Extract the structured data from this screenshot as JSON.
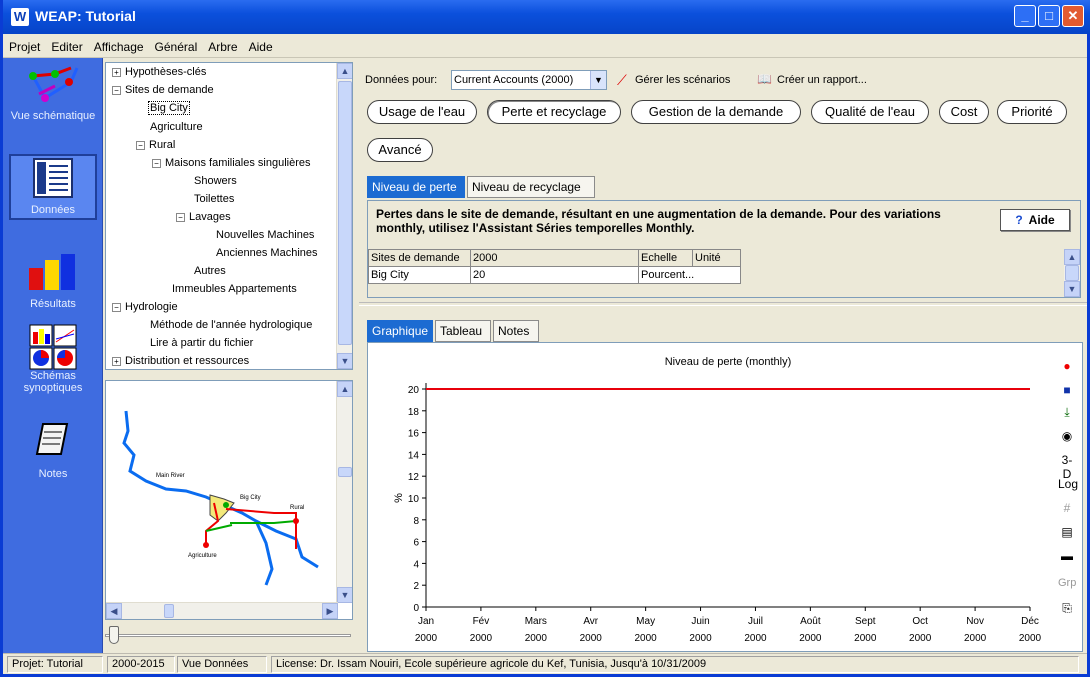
{
  "window": {
    "title": "WEAP: Tutorial",
    "app_icon": "W"
  },
  "menu": [
    "Projet",
    "Editer",
    "Affichage",
    "Général",
    "Arbre",
    "Aide"
  ],
  "nav": [
    {
      "label": "Vue schématique",
      "icon": "schematic-icon"
    },
    {
      "label": "Données",
      "icon": "data-icon"
    },
    {
      "label": "Résultats",
      "icon": "results-icon"
    },
    {
      "label": "Schémas synoptiques",
      "icon": "overviews-icon"
    },
    {
      "label": "Notes",
      "icon": "notes-icon"
    }
  ],
  "tree": [
    {
      "label": "Hypothèses-clés",
      "box": "+"
    },
    {
      "label": "Sites de demande",
      "box": "−"
    },
    {
      "label": "Big City",
      "selected": true
    },
    {
      "label": "Agriculture"
    },
    {
      "label": "Rural",
      "box": "−"
    },
    {
      "label": "Maisons familiales singulières",
      "box": "−"
    },
    {
      "label": "Showers"
    },
    {
      "label": "Toilettes"
    },
    {
      "label": "Lavages",
      "box": "−"
    },
    {
      "label": "Nouvelles Machines"
    },
    {
      "label": "Anciennes Machines"
    },
    {
      "label": "Autres"
    },
    {
      "label": "Immeubles Appartements"
    },
    {
      "label": "Hydrologie",
      "box": "−"
    },
    {
      "label": "Méthode de l'année hydrologique"
    },
    {
      "label": "Lire à partir du fichier"
    },
    {
      "label": "Distribution et ressources",
      "box": "+"
    }
  ],
  "map": {
    "labels": [
      "Main River",
      "Big City",
      "Rural",
      "Agriculture"
    ]
  },
  "toolbar": {
    "data_for_label": "Données pour:",
    "scenario_value": "Current Accounts (2000)",
    "manage_scenarios": "Gérer les scénarios",
    "create_report": "Créer un rapport..."
  },
  "category_buttons": [
    "Usage de l'eau",
    "Perte et recyclage",
    "Gestion de la demande",
    "Qualité de l'eau",
    "Cost",
    "Priorité",
    "Avancé"
  ],
  "subtabs": [
    "Niveau de perte",
    "Niveau de recyclage"
  ],
  "info": {
    "text": "Pertes dans le site de demande, résultant en une augmentation de la demande.  Pour des variations monthly, utilisez l'Assistant Séries temporelles Monthly.",
    "help_label": "Aide",
    "help_icon": "?"
  },
  "grid": {
    "headers": [
      "Sites de demande",
      "2000",
      "Echelle",
      "Unité"
    ],
    "rows": [
      [
        "Big City",
        "20",
        "Pourcent...",
        ""
      ]
    ]
  },
  "chart_tabs": [
    "Graphique",
    "Tableau",
    "Notes"
  ],
  "chart_tools": [
    "3-D",
    "Log",
    "Grp"
  ],
  "chart_data": {
    "type": "line",
    "title": "Niveau de perte (monthly)",
    "ylabel": "%",
    "xlabel": "",
    "categories": [
      "Jan",
      "Fév",
      "Mars",
      "Avr",
      "May",
      "Juin",
      "Juil",
      "Août",
      "Sept",
      "Oct",
      "Nov",
      "Déc"
    ],
    "year_labels": [
      "2000",
      "2000",
      "2000",
      "2000",
      "2000",
      "2000",
      "2000",
      "2000",
      "2000",
      "2000",
      "2000",
      "2000"
    ],
    "yticks": [
      "0",
      "2",
      "4",
      "6",
      "8",
      "10",
      "12",
      "14",
      "16",
      "18",
      "20"
    ],
    "series": [
      {
        "values": [
          20,
          20,
          20,
          20,
          20,
          20,
          20,
          20,
          20,
          20,
          20,
          20
        ],
        "color": "#e8000b"
      }
    ],
    "ylim": [
      0,
      20
    ],
    "grid": false
  },
  "status": {
    "project": "Projet: Tutorial",
    "years": "2000-2015",
    "view": "Vue Données",
    "license": "License: Dr. Issam Nouiri, Ecole supérieure agricole du Kef, Tunisia, Jusqu'à 10/31/2009"
  }
}
